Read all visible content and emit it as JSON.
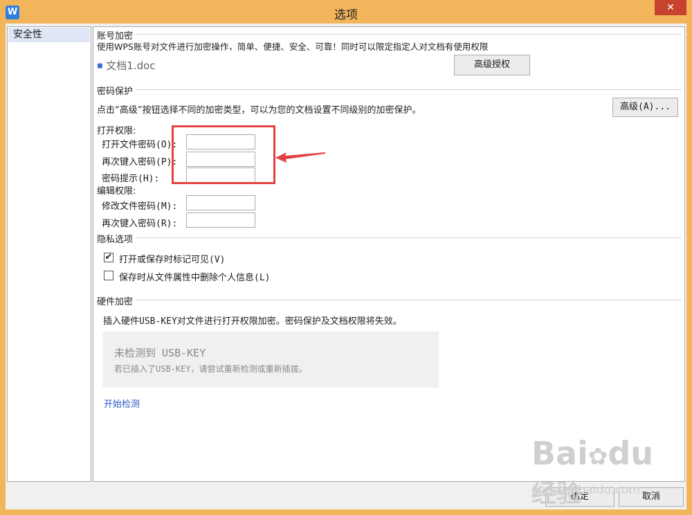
{
  "window": {
    "title": "选项",
    "close_symbol": "✕",
    "app_icon_glyph": "W"
  },
  "sidebar": {
    "items": [
      {
        "label": "安全性",
        "selected": true
      }
    ]
  },
  "account_encrypt": {
    "title": "账号加密",
    "description": "使用WPS账号对文件进行加密操作，简单、便捷、安全、可靠！同时可以限定指定人对文档有使用权限",
    "file_name": "文档1.doc",
    "advanced_auth_button": "高级授权"
  },
  "password_protection": {
    "title": "密码保护",
    "description": "点击“高级”按钮选择不同的加密类型，可以为您的文档设置不同级别的加密保护。",
    "advanced_button": "高级(A)..."
  },
  "open_permission": {
    "title": "打开权限:",
    "open_password_label": "打开文件密码(O):",
    "open_password_value": "",
    "reenter_password_label": "再次键入密码(P):",
    "reenter_password_value": "",
    "hint_label": "密码提示(H):",
    "hint_value": ""
  },
  "edit_permission": {
    "title": "编辑权限:",
    "modify_password_label": "修改文件密码(M):",
    "modify_password_value": "",
    "reenter_password_label": "再次键入密码(R):",
    "reenter_password_value": ""
  },
  "privacy": {
    "title": "隐私选项",
    "options": [
      {
        "label": "打开或保存时标记可见(V)",
        "checked": true
      },
      {
        "label": "保存时从文件属性中删除个人信息(L)",
        "checked": false
      }
    ],
    "check_mark": "✔"
  },
  "hardware_encrypt": {
    "title": "硬件加密",
    "description": "插入硬件USB-KEY对文件进行打开权限加密。密码保护及文档权限将失效。",
    "usb_status_title": "未检测到 USB-KEY",
    "usb_status_hint": "若已插入了USB-KEY，请尝试重新检测或重新插拔。",
    "start_detect_link": "开始检测"
  },
  "footer": {
    "ok_button": "确定",
    "cancel_button": "取消"
  },
  "watermark": {
    "brand": "Bai",
    "brand_suffix": "du",
    "brand_cn": "经验",
    "url": "jingyan.baidu.com"
  },
  "colors": {
    "frame": "#f3b55b",
    "close_button": "#c7432e",
    "annotation": "#e34141",
    "link": "#2b57c8",
    "selected_item": "#dfe6f5"
  }
}
